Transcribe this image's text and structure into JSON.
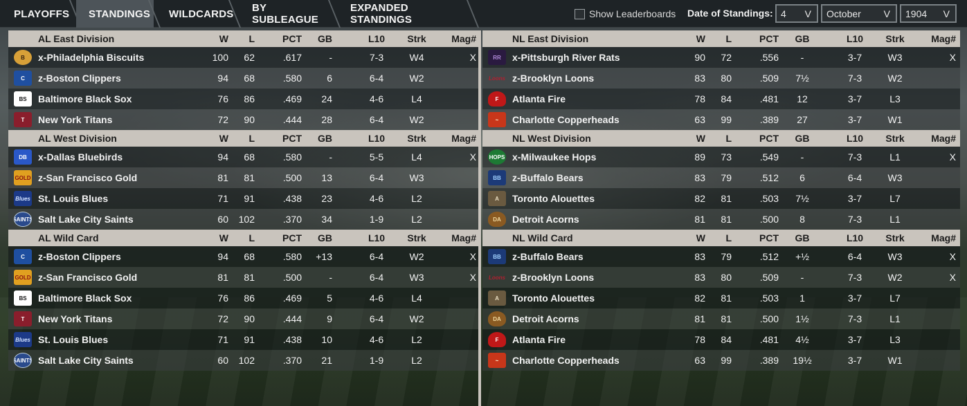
{
  "tabs": [
    "PLAYOFFS",
    "STANDINGS",
    "WILDCARDS",
    "BY SUBLEAGUE",
    "EXPANDED STANDINGS"
  ],
  "active_tab": "STANDINGS",
  "show_leaderboards_label": "Show Leaderboards",
  "date_label": "Date of Standings:",
  "date_day": "4",
  "date_month": "October",
  "date_year": "1904",
  "chevron": "V",
  "columns": [
    "W",
    "L",
    "PCT",
    "GB",
    "L10",
    "Strk",
    "Mag#"
  ],
  "left": [
    {
      "title": "AL East Division",
      "rows": [
        {
          "logo": "philadelphia-biscuits-logo",
          "logo_text": "B",
          "name": "x-Philadelphia Biscuits",
          "w": "100",
          "l": "62",
          "pct": ".617",
          "gb": "-",
          "l10": "7-3",
          "strk": "W4",
          "mag": "X"
        },
        {
          "logo": "boston-clippers-logo",
          "logo_text": "C",
          "name": "z-Boston Clippers",
          "w": "94",
          "l": "68",
          "pct": ".580",
          "gb": "6",
          "l10": "6-4",
          "strk": "W2",
          "mag": ""
        },
        {
          "logo": "baltimore-black-sox-logo",
          "logo_text": "BS",
          "name": "Baltimore Black Sox",
          "w": "76",
          "l": "86",
          "pct": ".469",
          "gb": "24",
          "l10": "4-6",
          "strk": "L4",
          "mag": ""
        },
        {
          "logo": "new-york-titans-logo",
          "logo_text": "T",
          "name": "New York Titans",
          "w": "72",
          "l": "90",
          "pct": ".444",
          "gb": "28",
          "l10": "6-4",
          "strk": "W2",
          "mag": ""
        }
      ]
    },
    {
      "title": "AL West Division",
      "rows": [
        {
          "logo": "dallas-bluebirds-logo",
          "logo_text": "DB",
          "name": "x-Dallas Bluebirds",
          "w": "94",
          "l": "68",
          "pct": ".580",
          "gb": "-",
          "l10": "5-5",
          "strk": "L4",
          "mag": "X"
        },
        {
          "logo": "san-francisco-gold-logo",
          "logo_text": "GOLD",
          "name": "z-San Francisco Gold",
          "w": "81",
          "l": "81",
          "pct": ".500",
          "gb": "13",
          "l10": "6-4",
          "strk": "W3",
          "mag": ""
        },
        {
          "logo": "st-louis-blues-logo",
          "logo_text": "Blues",
          "name": "St. Louis Blues",
          "w": "71",
          "l": "91",
          "pct": ".438",
          "gb": "23",
          "l10": "4-6",
          "strk": "L2",
          "mag": ""
        },
        {
          "logo": "salt-lake-city-saints-logo",
          "logo_text": "SAINTS",
          "name": "Salt Lake City Saints",
          "w": "60",
          "l": "102",
          "pct": ".370",
          "gb": "34",
          "l10": "1-9",
          "strk": "L2",
          "mag": ""
        }
      ]
    },
    {
      "title": "AL  Wild Card",
      "rows": [
        {
          "logo": "boston-clippers-logo",
          "logo_text": "C",
          "name": "z-Boston Clippers",
          "w": "94",
          "l": "68",
          "pct": ".580",
          "gb": "+13",
          "l10": "6-4",
          "strk": "W2",
          "mag": "X"
        },
        {
          "logo": "san-francisco-gold-logo",
          "logo_text": "GOLD",
          "name": "z-San Francisco Gold",
          "w": "81",
          "l": "81",
          "pct": ".500",
          "gb": "-",
          "l10": "6-4",
          "strk": "W3",
          "mag": "X"
        },
        {
          "logo": "baltimore-black-sox-logo",
          "logo_text": "BS",
          "name": "Baltimore Black Sox",
          "w": "76",
          "l": "86",
          "pct": ".469",
          "gb": "5",
          "l10": "4-6",
          "strk": "L4",
          "mag": ""
        },
        {
          "logo": "new-york-titans-logo",
          "logo_text": "T",
          "name": "New York Titans",
          "w": "72",
          "l": "90",
          "pct": ".444",
          "gb": "9",
          "l10": "6-4",
          "strk": "W2",
          "mag": ""
        },
        {
          "logo": "st-louis-blues-logo",
          "logo_text": "Blues",
          "name": "St. Louis Blues",
          "w": "71",
          "l": "91",
          "pct": ".438",
          "gb": "10",
          "l10": "4-6",
          "strk": "L2",
          "mag": ""
        },
        {
          "logo": "salt-lake-city-saints-logo",
          "logo_text": "SAINTS",
          "name": "Salt Lake City Saints",
          "w": "60",
          "l": "102",
          "pct": ".370",
          "gb": "21",
          "l10": "1-9",
          "strk": "L2",
          "mag": ""
        }
      ]
    }
  ],
  "right": [
    {
      "title": "NL East Division",
      "rows": [
        {
          "logo": "pittsburgh-river-rats-logo",
          "logo_text": "RR",
          "name": "x-Pittsburgh River Rats",
          "w": "90",
          "l": "72",
          "pct": ".556",
          "gb": "-",
          "l10": "3-7",
          "strk": "W3",
          "mag": "X"
        },
        {
          "logo": "brooklyn-loons-logo",
          "logo_text": "Loons",
          "name": "z-Brooklyn Loons",
          "w": "83",
          "l": "80",
          "pct": ".509",
          "gb": "7½",
          "l10": "7-3",
          "strk": "W2",
          "mag": ""
        },
        {
          "logo": "atlanta-fire-logo",
          "logo_text": "F",
          "name": "Atlanta Fire",
          "w": "78",
          "l": "84",
          "pct": ".481",
          "gb": "12",
          "l10": "3-7",
          "strk": "L3",
          "mag": ""
        },
        {
          "logo": "charlotte-copperheads-logo",
          "logo_text": "~",
          "name": "Charlotte Copperheads",
          "w": "63",
          "l": "99",
          "pct": ".389",
          "gb": "27",
          "l10": "3-7",
          "strk": "W1",
          "mag": ""
        }
      ]
    },
    {
      "title": "NL West Division",
      "rows": [
        {
          "logo": "milwaukee-hops-logo",
          "logo_text": "HOPS",
          "name": "x-Milwaukee Hops",
          "w": "89",
          "l": "73",
          "pct": ".549",
          "gb": "-",
          "l10": "7-3",
          "strk": "L1",
          "mag": "X"
        },
        {
          "logo": "buffalo-bears-logo",
          "logo_text": "BB",
          "name": "z-Buffalo Bears",
          "w": "83",
          "l": "79",
          "pct": ".512",
          "gb": "6",
          "l10": "6-4",
          "strk": "W3",
          "mag": ""
        },
        {
          "logo": "toronto-alouettes-logo",
          "logo_text": "A",
          "name": "Toronto  Alouettes",
          "w": "82",
          "l": "81",
          "pct": ".503",
          "gb": "7½",
          "l10": "3-7",
          "strk": "L7",
          "mag": ""
        },
        {
          "logo": "detroit-acorns-logo",
          "logo_text": "DA",
          "name": "Detroit Acorns",
          "w": "81",
          "l": "81",
          "pct": ".500",
          "gb": "8",
          "l10": "7-3",
          "strk": "L1",
          "mag": ""
        }
      ]
    },
    {
      "title": "NL  Wild Card",
      "rows": [
        {
          "logo": "buffalo-bears-logo",
          "logo_text": "BB",
          "name": "z-Buffalo Bears",
          "w": "83",
          "l": "79",
          "pct": ".512",
          "gb": "+½",
          "l10": "6-4",
          "strk": "W3",
          "mag": "X"
        },
        {
          "logo": "brooklyn-loons-logo",
          "logo_text": "Loons",
          "name": "z-Brooklyn Loons",
          "w": "83",
          "l": "80",
          "pct": ".509",
          "gb": "-",
          "l10": "7-3",
          "strk": "W2",
          "mag": "X"
        },
        {
          "logo": "toronto-alouettes-logo",
          "logo_text": "A",
          "name": "Toronto  Alouettes",
          "w": "82",
          "l": "81",
          "pct": ".503",
          "gb": "1",
          "l10": "3-7",
          "strk": "L7",
          "mag": ""
        },
        {
          "logo": "detroit-acorns-logo",
          "logo_text": "DA",
          "name": "Detroit Acorns",
          "w": "81",
          "l": "81",
          "pct": ".500",
          "gb": "1½",
          "l10": "7-3",
          "strk": "L1",
          "mag": ""
        },
        {
          "logo": "atlanta-fire-logo",
          "logo_text": "F",
          "name": "Atlanta Fire",
          "w": "78",
          "l": "84",
          "pct": ".481",
          "gb": "4½",
          "l10": "3-7",
          "strk": "L3",
          "mag": ""
        },
        {
          "logo": "charlotte-copperheads-logo",
          "logo_text": "~",
          "name": "Charlotte Copperheads",
          "w": "63",
          "l": "99",
          "pct": ".389",
          "gb": "19½",
          "l10": "3-7",
          "strk": "W1",
          "mag": ""
        }
      ]
    }
  ],
  "colors": {
    "header_band": "#c9c4bd",
    "topbar": "#1e2326",
    "active_tab": "#4d5459"
  }
}
